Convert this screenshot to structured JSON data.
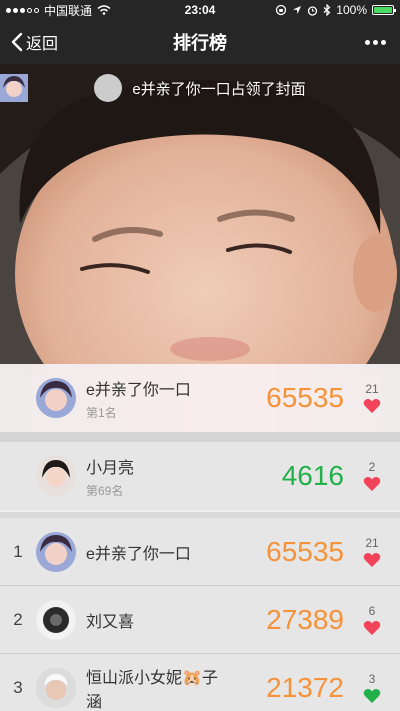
{
  "status": {
    "carrier": "中国联通",
    "time": "23:04",
    "battery": "100%",
    "battery_level": 1.0
  },
  "nav": {
    "back": "返回",
    "title": "排行榜"
  },
  "cover": {
    "caption": "e并亲了你一口占领了封面"
  },
  "mine": [
    {
      "name": "e并亲了你一口",
      "rank_text": "第1名",
      "score": "65535",
      "likes": "21",
      "color": "orange"
    },
    {
      "name": "小月亮",
      "rank_text": "第69名",
      "score": "4616",
      "likes": "2",
      "color": "green"
    }
  ],
  "ranking": [
    {
      "rank": "1",
      "name": "e并亲了你一口",
      "score": "65535",
      "likes": "21"
    },
    {
      "rank": "2",
      "name": "刘又喜",
      "score": "27389",
      "likes": "6"
    },
    {
      "rank": "3",
      "name": "恒山派小女妮🐹子涵",
      "score": "21372",
      "likes": "3"
    }
  ],
  "colors": {
    "score_orange": "#f5923a",
    "score_green": "#22b04b",
    "heart": "#f2435a",
    "nav_bg": "#262626"
  },
  "icons": {
    "back": "chevron-left-icon",
    "more": "more-dots-icon",
    "heart": "heart-icon",
    "wifi": "wifi-icon"
  }
}
